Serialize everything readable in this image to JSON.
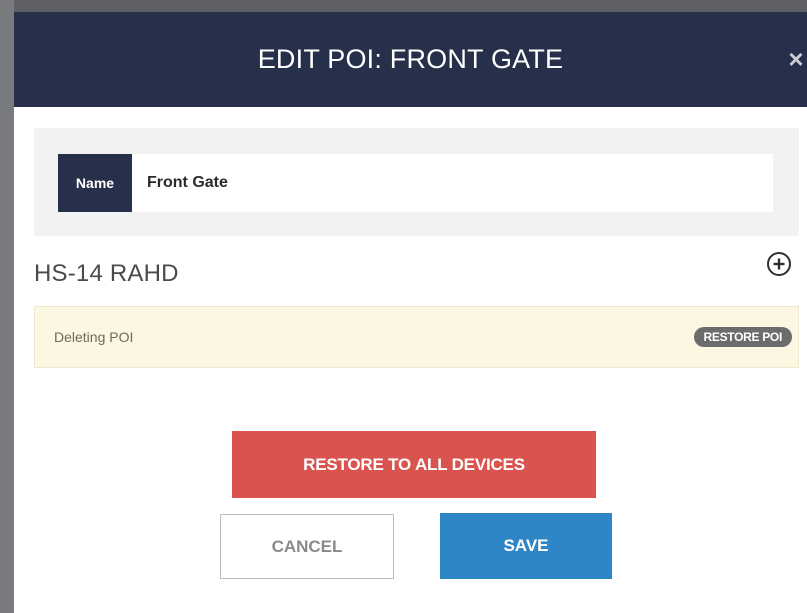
{
  "modal": {
    "title": "EDIT POI: FRONT GATE",
    "close_icon": "close-icon",
    "close_glyph": "×"
  },
  "name_field": {
    "label": "Name",
    "value": "Front Gate"
  },
  "device": {
    "title": "HS-14 RAHD",
    "add_icon": "plus-circle-icon"
  },
  "poi_status": {
    "message": "Deleting POI",
    "restore_label": "RESTORE POI"
  },
  "actions": {
    "restore_all_label": "RESTORE TO ALL DEVICES",
    "cancel_label": "CANCEL",
    "save_label": "SAVE"
  },
  "colors": {
    "header_bg": "#26304a",
    "danger": "#d9534f",
    "primary": "#2f86c6",
    "warning_bg": "#fcf7e3"
  }
}
